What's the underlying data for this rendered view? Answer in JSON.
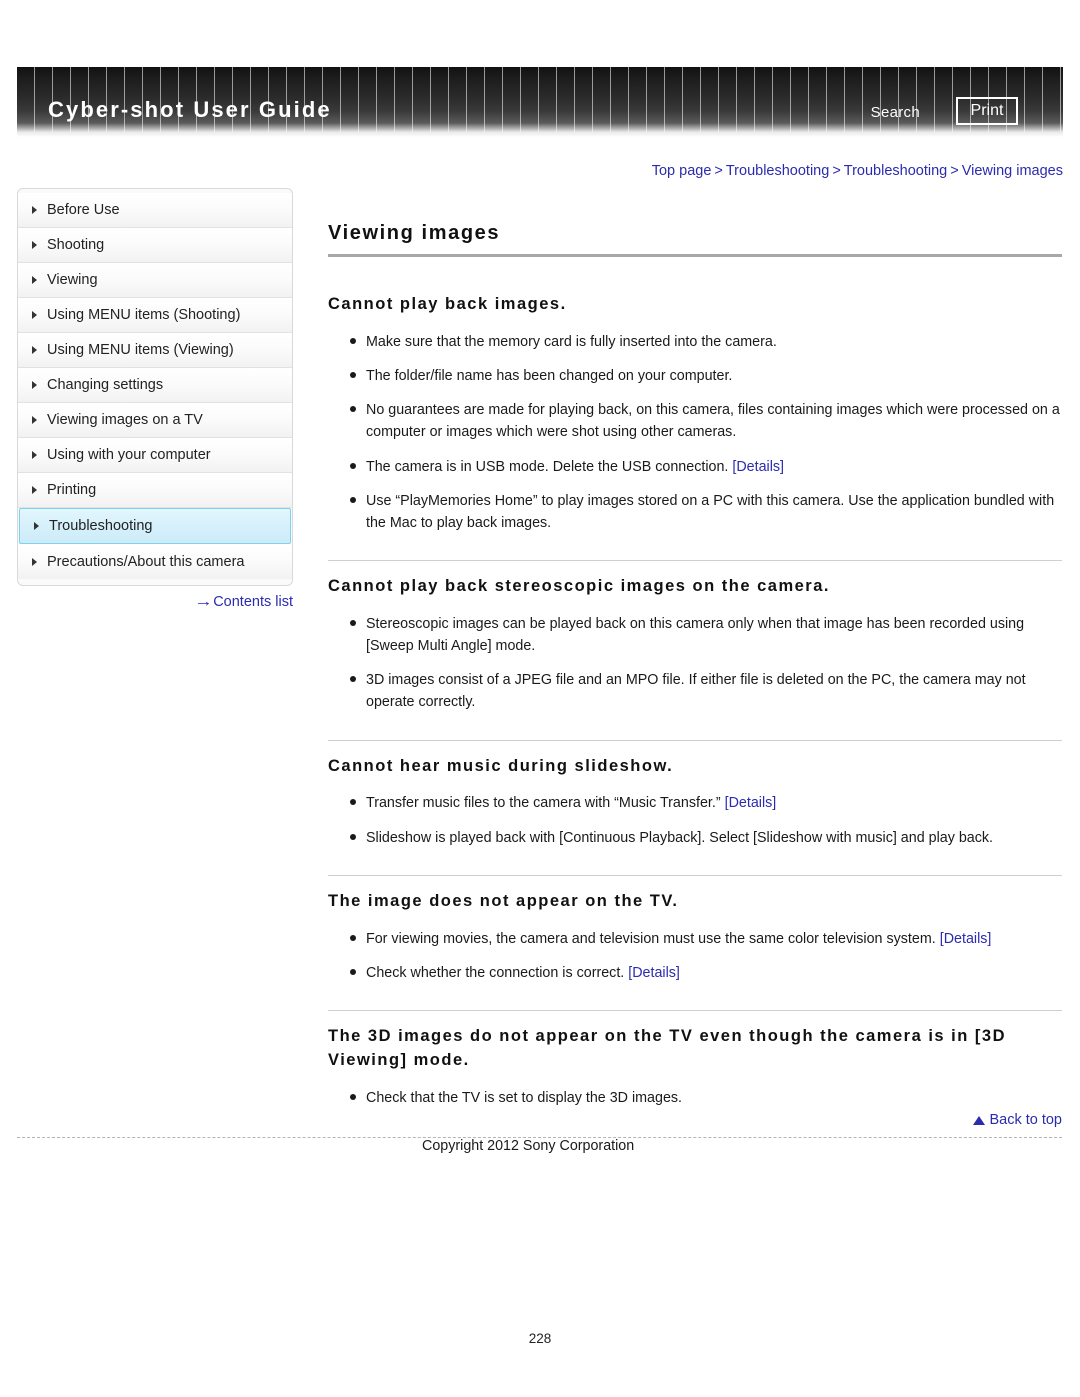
{
  "header": {
    "title": "Cyber-shot User Guide",
    "search_label": "Search",
    "print_label": "Print"
  },
  "breadcrumb": {
    "items": [
      "Top page",
      "Troubleshooting",
      "Troubleshooting",
      "Viewing images"
    ],
    "separator": ">"
  },
  "sidebar": {
    "items": [
      {
        "label": "Before Use",
        "active": false
      },
      {
        "label": "Shooting",
        "active": false
      },
      {
        "label": "Viewing",
        "active": false
      },
      {
        "label": "Using MENU items (Shooting)",
        "active": false
      },
      {
        "label": "Using MENU items (Viewing)",
        "active": false
      },
      {
        "label": "Changing settings",
        "active": false
      },
      {
        "label": "Viewing images on a TV",
        "active": false
      },
      {
        "label": "Using with your computer",
        "active": false
      },
      {
        "label": "Printing",
        "active": false
      },
      {
        "label": "Troubleshooting",
        "active": true
      },
      {
        "label": "Precautions/About this camera",
        "active": false
      }
    ],
    "contents_list_label": "Contents list",
    "contents_list_arrow": "→",
    "highlight_color": "#d5f0fb",
    "highlight_border_color": "#7fd2ec"
  },
  "main": {
    "page_title": "Viewing images",
    "sections": [
      {
        "heading": "Cannot play back images.",
        "rule_above": false,
        "items": [
          {
            "text": "Make sure that the memory card is fully inserted into the camera.",
            "link": null
          },
          {
            "text": "The folder/file name has been changed on your computer.",
            "link": null
          },
          {
            "text": "No guarantees are made for playing back, on this camera, files containing images which were processed on a computer or images which were shot using other cameras.",
            "link": null
          },
          {
            "text": "The camera is in USB mode. Delete the USB connection.",
            "link": "[Details]"
          },
          {
            "text": "Use “PlayMemories Home” to play images stored on a PC with this camera. Use the application bundled with the Mac to play back images.",
            "link": null
          }
        ]
      },
      {
        "heading": "Cannot play back stereoscopic images on the camera.",
        "rule_above": true,
        "items": [
          {
            "text": "Stereoscopic images can be played back on this camera only when that image has been recorded using [Sweep Multi Angle] mode.",
            "link": null
          },
          {
            "text": "3D images consist of a JPEG file and an MPO file. If either file is deleted on the PC, the camera may not operate correctly.",
            "link": null
          }
        ]
      },
      {
        "heading": "Cannot hear music during slideshow.",
        "rule_above": true,
        "items": [
          {
            "text": "Transfer music files to the camera with “Music Transfer.”",
            "link": "[Details]"
          },
          {
            "text": "Slideshow is played back with [Continuous Playback]. Select [Slideshow with music] and play back.",
            "link": null
          }
        ]
      },
      {
        "heading": "The image does not appear on the TV.",
        "rule_above": true,
        "items": [
          {
            "text": "For viewing movies, the camera and television must use the same color television system.",
            "link": "[Details]"
          },
          {
            "text": "Check whether the connection is correct.",
            "link": "[Details]"
          }
        ]
      },
      {
        "heading": "The 3D images do not appear on the TV even though the camera is in [3D Viewing] mode.",
        "rule_above": true,
        "items": [
          {
            "text": "Check that the TV is set to display the 3D images.",
            "link": null
          }
        ]
      }
    ]
  },
  "footer": {
    "back_to_top_label": "Back to top",
    "copyright": "Copyright 2012 Sony Corporation",
    "page_number": "228"
  },
  "colors": {
    "link": "#2b2bb0",
    "header_dark": "#1d1d1d",
    "rule": "#a8a8a8"
  }
}
